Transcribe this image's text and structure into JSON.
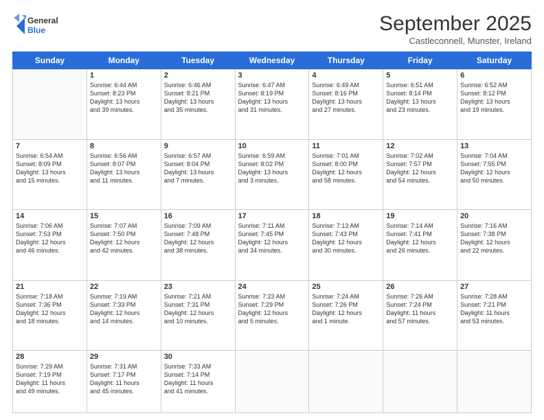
{
  "logo": {
    "general": "General",
    "blue": "Blue"
  },
  "header": {
    "month": "September 2025",
    "location": "Castleconnell, Munster, Ireland"
  },
  "days": [
    "Sunday",
    "Monday",
    "Tuesday",
    "Wednesday",
    "Thursday",
    "Friday",
    "Saturday"
  ],
  "weeks": [
    [
      {
        "num": "",
        "text": ""
      },
      {
        "num": "1",
        "text": "Sunrise: 6:44 AM\nSunset: 8:23 PM\nDaylight: 13 hours\nand 39 minutes."
      },
      {
        "num": "2",
        "text": "Sunrise: 6:46 AM\nSunset: 8:21 PM\nDaylight: 13 hours\nand 35 minutes."
      },
      {
        "num": "3",
        "text": "Sunrise: 6:47 AM\nSunset: 8:19 PM\nDaylight: 13 hours\nand 31 minutes."
      },
      {
        "num": "4",
        "text": "Sunrise: 6:49 AM\nSunset: 8:16 PM\nDaylight: 13 hours\nand 27 minutes."
      },
      {
        "num": "5",
        "text": "Sunrise: 6:51 AM\nSunset: 8:14 PM\nDaylight: 13 hours\nand 23 minutes."
      },
      {
        "num": "6",
        "text": "Sunrise: 6:52 AM\nSunset: 8:12 PM\nDaylight: 13 hours\nand 19 minutes."
      }
    ],
    [
      {
        "num": "7",
        "text": "Sunrise: 6:54 AM\nSunset: 8:09 PM\nDaylight: 13 hours\nand 15 minutes."
      },
      {
        "num": "8",
        "text": "Sunrise: 6:56 AM\nSunset: 8:07 PM\nDaylight: 13 hours\nand 11 minutes."
      },
      {
        "num": "9",
        "text": "Sunrise: 6:57 AM\nSunset: 8:04 PM\nDaylight: 13 hours\nand 7 minutes."
      },
      {
        "num": "10",
        "text": "Sunrise: 6:59 AM\nSunset: 8:02 PM\nDaylight: 13 hours\nand 3 minutes."
      },
      {
        "num": "11",
        "text": "Sunrise: 7:01 AM\nSunset: 8:00 PM\nDaylight: 12 hours\nand 58 minutes."
      },
      {
        "num": "12",
        "text": "Sunrise: 7:02 AM\nSunset: 7:57 PM\nDaylight: 12 hours\nand 54 minutes."
      },
      {
        "num": "13",
        "text": "Sunrise: 7:04 AM\nSunset: 7:55 PM\nDaylight: 12 hours\nand 50 minutes."
      }
    ],
    [
      {
        "num": "14",
        "text": "Sunrise: 7:06 AM\nSunset: 7:53 PM\nDaylight: 12 hours\nand 46 minutes."
      },
      {
        "num": "15",
        "text": "Sunrise: 7:07 AM\nSunset: 7:50 PM\nDaylight: 12 hours\nand 42 minutes."
      },
      {
        "num": "16",
        "text": "Sunrise: 7:09 AM\nSunset: 7:48 PM\nDaylight: 12 hours\nand 38 minutes."
      },
      {
        "num": "17",
        "text": "Sunrise: 7:11 AM\nSunset: 7:45 PM\nDaylight: 12 hours\nand 34 minutes."
      },
      {
        "num": "18",
        "text": "Sunrise: 7:13 AM\nSunset: 7:43 PM\nDaylight: 12 hours\nand 30 minutes."
      },
      {
        "num": "19",
        "text": "Sunrise: 7:14 AM\nSunset: 7:41 PM\nDaylight: 12 hours\nand 26 minutes."
      },
      {
        "num": "20",
        "text": "Sunrise: 7:16 AM\nSunset: 7:38 PM\nDaylight: 12 hours\nand 22 minutes."
      }
    ],
    [
      {
        "num": "21",
        "text": "Sunrise: 7:18 AM\nSunset: 7:36 PM\nDaylight: 12 hours\nand 18 minutes."
      },
      {
        "num": "22",
        "text": "Sunrise: 7:19 AM\nSunset: 7:33 PM\nDaylight: 12 hours\nand 14 minutes."
      },
      {
        "num": "23",
        "text": "Sunrise: 7:21 AM\nSunset: 7:31 PM\nDaylight: 12 hours\nand 10 minutes."
      },
      {
        "num": "24",
        "text": "Sunrise: 7:23 AM\nSunset: 7:29 PM\nDaylight: 12 hours\nand 5 minutes."
      },
      {
        "num": "25",
        "text": "Sunrise: 7:24 AM\nSunset: 7:26 PM\nDaylight: 12 hours\nand 1 minute."
      },
      {
        "num": "26",
        "text": "Sunrise: 7:26 AM\nSunset: 7:24 PM\nDaylight: 11 hours\nand 57 minutes."
      },
      {
        "num": "27",
        "text": "Sunrise: 7:28 AM\nSunset: 7:21 PM\nDaylight: 11 hours\nand 53 minutes."
      }
    ],
    [
      {
        "num": "28",
        "text": "Sunrise: 7:29 AM\nSunset: 7:19 PM\nDaylight: 11 hours\nand 49 minutes."
      },
      {
        "num": "29",
        "text": "Sunrise: 7:31 AM\nSunset: 7:17 PM\nDaylight: 11 hours\nand 45 minutes."
      },
      {
        "num": "30",
        "text": "Sunrise: 7:33 AM\nSunset: 7:14 PM\nDaylight: 11 hours\nand 41 minutes."
      },
      {
        "num": "",
        "text": ""
      },
      {
        "num": "",
        "text": ""
      },
      {
        "num": "",
        "text": ""
      },
      {
        "num": "",
        "text": ""
      }
    ]
  ]
}
